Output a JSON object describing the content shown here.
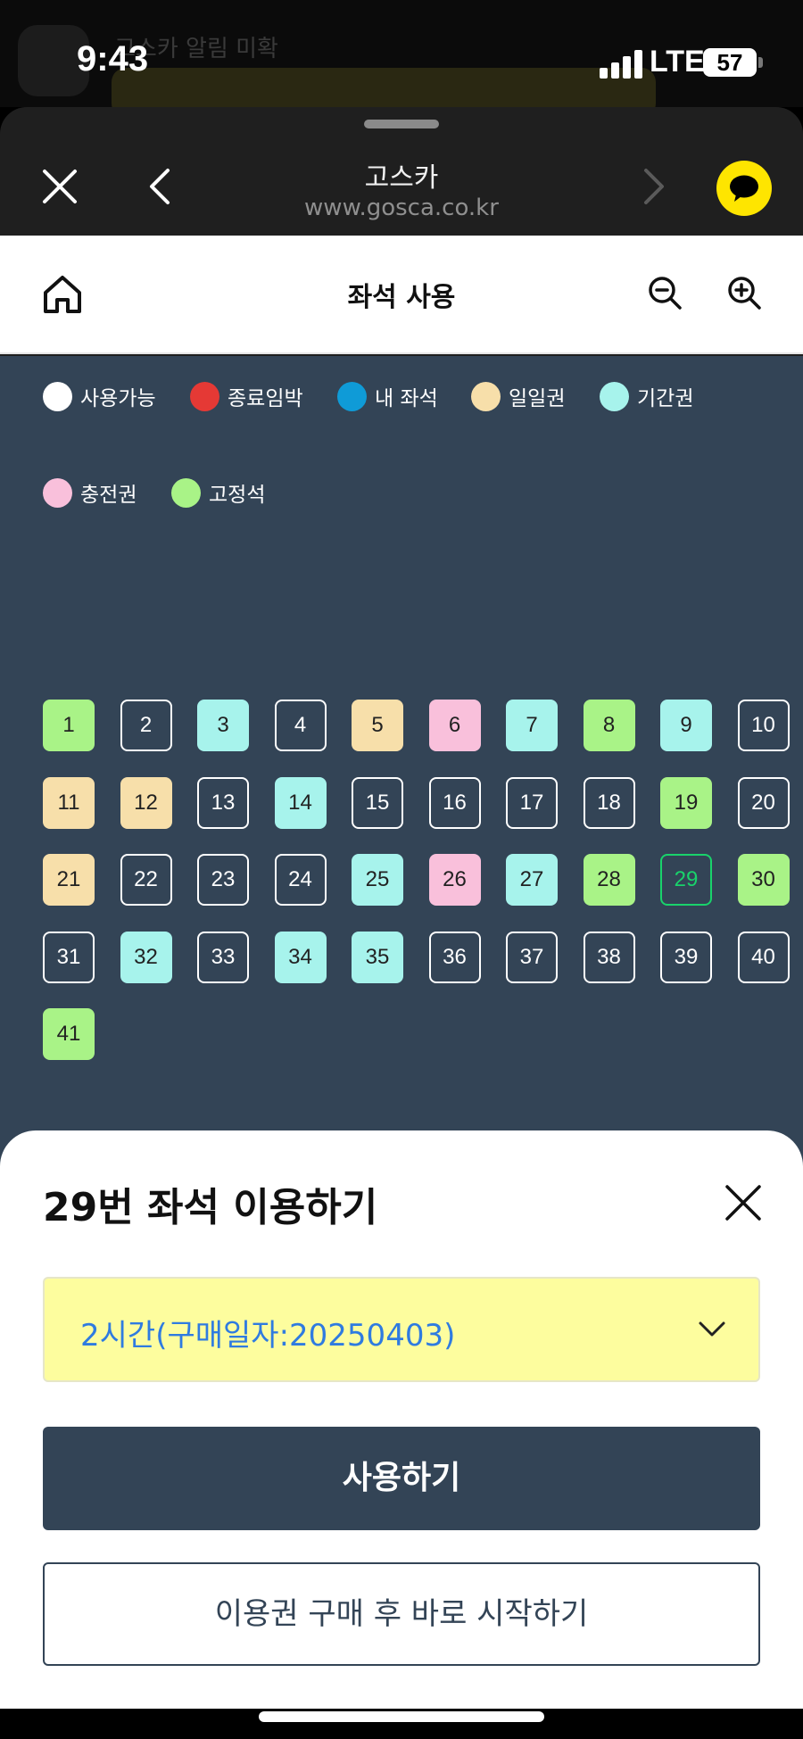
{
  "status_bar": {
    "time": "9:43",
    "network": "LTE",
    "battery": "57",
    "background_notification": "고스카 알림 미확"
  },
  "browser": {
    "title": "고스카",
    "url": "www.gosca.co.kr"
  },
  "page": {
    "title": "좌석 사용"
  },
  "legend": [
    {
      "label": "사용가능",
      "color": "#ffffff"
    },
    {
      "label": "종료임박",
      "color": "#e53935"
    },
    {
      "label": "내 좌석",
      "color": "#0f9bd7"
    },
    {
      "label": "일일권",
      "color": "#f7dfaa"
    },
    {
      "label": "기간권",
      "color": "#a7f3ec"
    },
    {
      "label": "충전권",
      "color": "#f9c0db"
    },
    {
      "label": "고정석",
      "color": "#a9f387"
    }
  ],
  "seats": [
    {
      "n": "1",
      "state": "fixed"
    },
    {
      "n": "2",
      "state": "available"
    },
    {
      "n": "3",
      "state": "period"
    },
    {
      "n": "4",
      "state": "available"
    },
    {
      "n": "5",
      "state": "daily"
    },
    {
      "n": "6",
      "state": "charge"
    },
    {
      "n": "7",
      "state": "period"
    },
    {
      "n": "8",
      "state": "fixed"
    },
    {
      "n": "9",
      "state": "period"
    },
    {
      "n": "10",
      "state": "available"
    },
    {
      "n": "11",
      "state": "daily"
    },
    {
      "n": "12",
      "state": "daily"
    },
    {
      "n": "13",
      "state": "available"
    },
    {
      "n": "14",
      "state": "period"
    },
    {
      "n": "15",
      "state": "available"
    },
    {
      "n": "16",
      "state": "available"
    },
    {
      "n": "17",
      "state": "available"
    },
    {
      "n": "18",
      "state": "available"
    },
    {
      "n": "19",
      "state": "fixed"
    },
    {
      "n": "20",
      "state": "available"
    },
    {
      "n": "21",
      "state": "daily"
    },
    {
      "n": "22",
      "state": "available"
    },
    {
      "n": "23",
      "state": "available"
    },
    {
      "n": "24",
      "state": "available"
    },
    {
      "n": "25",
      "state": "period"
    },
    {
      "n": "26",
      "state": "charge"
    },
    {
      "n": "27",
      "state": "period"
    },
    {
      "n": "28",
      "state": "fixed"
    },
    {
      "n": "29",
      "state": "selected"
    },
    {
      "n": "30",
      "state": "fixed"
    },
    {
      "n": "31",
      "state": "available"
    },
    {
      "n": "32",
      "state": "period"
    },
    {
      "n": "33",
      "state": "available"
    },
    {
      "n": "34",
      "state": "period"
    },
    {
      "n": "35",
      "state": "period"
    },
    {
      "n": "36",
      "state": "available"
    },
    {
      "n": "37",
      "state": "available"
    },
    {
      "n": "38",
      "state": "available"
    },
    {
      "n": "39",
      "state": "available"
    },
    {
      "n": "40",
      "state": "available"
    },
    {
      "n": "41",
      "state": "fixed"
    }
  ],
  "seat_colors": {
    "fixed": "#a9f387",
    "period": "#a7f3ec",
    "daily": "#f7dfaa",
    "charge": "#f9c0db",
    "available": "transparent",
    "selected": "transparent"
  },
  "bottom_sheet": {
    "title": "29번 좌석 이용하기",
    "ticket_selected": "2시간(구매일자:20250403)",
    "use_button": "사용하기",
    "buy_button": "이용권 구매 후 바로 시작하기"
  },
  "icons": [
    "close-icon",
    "back-icon",
    "forward-icon",
    "kakao-chat-icon",
    "home-icon",
    "zoom-out-icon",
    "zoom-in-icon",
    "chevron-down-icon"
  ]
}
